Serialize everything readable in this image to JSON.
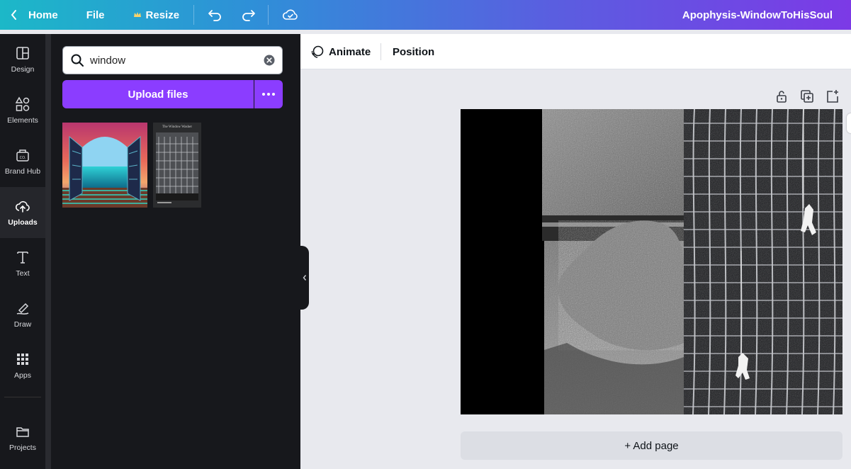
{
  "topbar": {
    "home": "Home",
    "file": "File",
    "resize": "Resize",
    "title": "Apophysis-WindowToHisSoul"
  },
  "rail": {
    "items": [
      {
        "label": "Design",
        "icon": "layout-icon"
      },
      {
        "label": "Elements",
        "icon": "shapes-icon"
      },
      {
        "label": "Brand Hub",
        "icon": "brand-icon"
      },
      {
        "label": "Uploads",
        "icon": "cloud-upload-icon"
      },
      {
        "label": "Text",
        "icon": "text-icon"
      },
      {
        "label": "Draw",
        "icon": "pen-icon"
      },
      {
        "label": "Apps",
        "icon": "grid-icon"
      },
      {
        "label": "Projects",
        "icon": "folder-icon"
      }
    ]
  },
  "panel": {
    "search_value": "window",
    "upload_label": "Upload files",
    "thumb2_text": "The Window Washer"
  },
  "toolbar": {
    "animate": "Animate",
    "position": "Position"
  },
  "canvas": {
    "add_page": "+ Add page"
  },
  "colors": {
    "accent": "#8b3dff",
    "rail_bg": "#17181c",
    "workspace": "#e8e9ee"
  }
}
